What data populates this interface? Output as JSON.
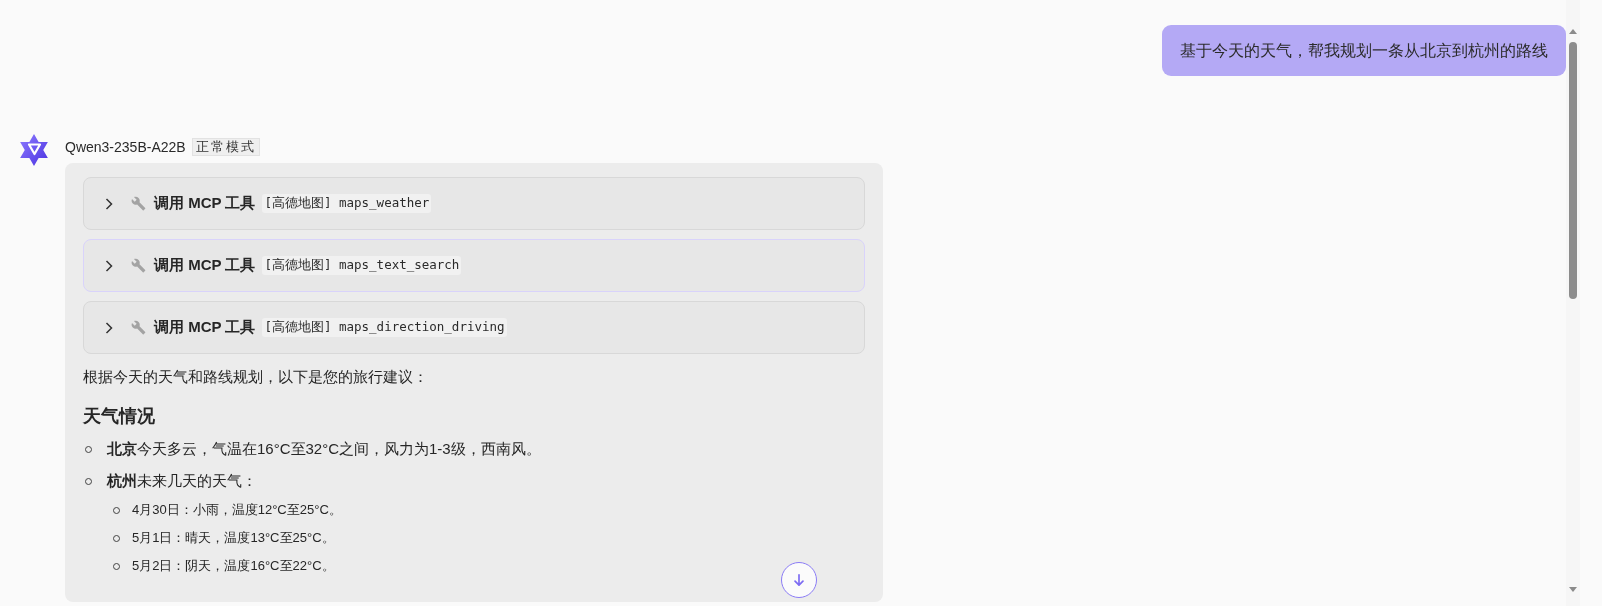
{
  "user_message": {
    "text": "基于今天的天气，帮我规划一条从北京到杭州的路线"
  },
  "assistant_message": {
    "model": "Qwen3-235B-A22B",
    "mode_badge": "正常模式",
    "tool_calls": [
      {
        "label": "调用 MCP 工具",
        "tool": "[高德地图] maps_weather",
        "expanded": false,
        "highlighted": false
      },
      {
        "label": "调用 MCP 工具",
        "tool": "[高德地图] maps_text_search",
        "expanded": false,
        "highlighted": true
      },
      {
        "label": "调用 MCP 工具",
        "tool": "[高德地图] maps_direction_driving",
        "expanded": false,
        "highlighted": false
      }
    ],
    "blocks": [
      {
        "kind": "paragraph",
        "text": "根据今天的天气和路线规划，以下是您的旅行建议："
      },
      {
        "kind": "heading",
        "text": "天气情况"
      },
      {
        "kind": "list",
        "items": [
          {
            "text": "**北京**今天多云，气温在16°C至32°C之间，风力为1-3级，西南风。"
          },
          {
            "text": "**杭州**未来几天的天气：",
            "children": [
              {
                "text": "4月30日：小雨，温度12°C至25°C。"
              },
              {
                "text": "5月1日：晴天，温度13°C至25°C。"
              },
              {
                "text": "5月2日：阴天，温度16°C至22°C。"
              }
            ]
          }
        ]
      }
    ]
  }
}
